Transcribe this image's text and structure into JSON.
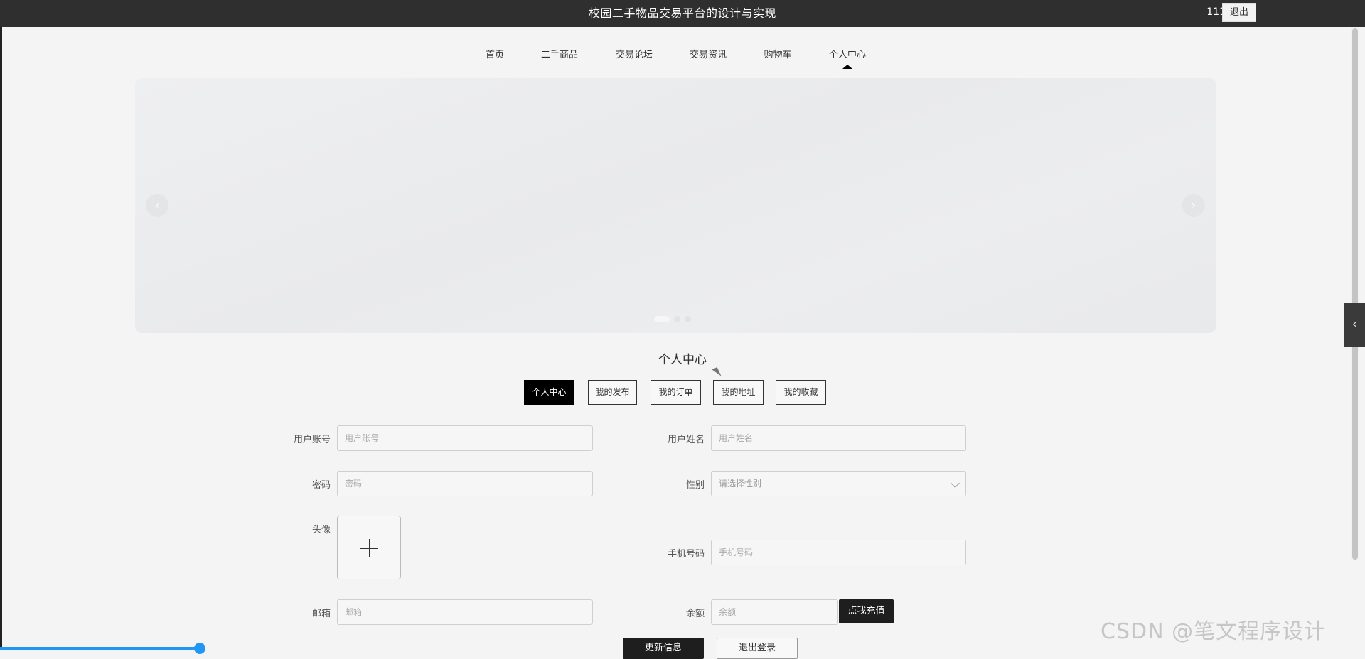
{
  "header": {
    "title": "校园二手物品交易平台的设计与实现",
    "username": "111",
    "logout_label": "退出"
  },
  "nav": {
    "items": [
      "首页",
      "二手商品",
      "交易论坛",
      "交易资讯",
      "购物车",
      "个人中心"
    ],
    "active_index": 5
  },
  "banner": {
    "prev_icon": "chevron-left-icon",
    "next_icon": "chevron-right-icon",
    "prev_glyph": "‹",
    "next_glyph": "›",
    "slide_count": 3,
    "active_slide": 0
  },
  "section": {
    "title": "个人中心",
    "tabs": [
      "个人中心",
      "我的发布",
      "我的订单",
      "我的地址",
      "我的收藏"
    ],
    "active_tab": 0
  },
  "form": {
    "account": {
      "label": "用户账号",
      "placeholder": "用户账号"
    },
    "name": {
      "label": "用户姓名",
      "placeholder": "用户姓名"
    },
    "password": {
      "label": "密码",
      "placeholder": "密码"
    },
    "gender": {
      "label": "性别",
      "placeholder": "请选择性别"
    },
    "avatar": {
      "label": "头像"
    },
    "phone": {
      "label": "手机号码",
      "placeholder": "手机号码"
    },
    "email": {
      "label": "邮箱",
      "placeholder": "邮箱"
    },
    "balance": {
      "label": "余额",
      "placeholder": "余额"
    },
    "recharge_label": "点我充值",
    "update_label": "更新信息",
    "logout_label": "退出登录"
  },
  "sidebar_toggle": {
    "glyph": "‹"
  },
  "watermark": "CSDN @笔文程序设计",
  "colors": {
    "header_bg": "#2f2f2f",
    "page_bg": "#f4f4f4",
    "active_tab_bg": "#000000",
    "progress_blue": "#2196f3"
  }
}
